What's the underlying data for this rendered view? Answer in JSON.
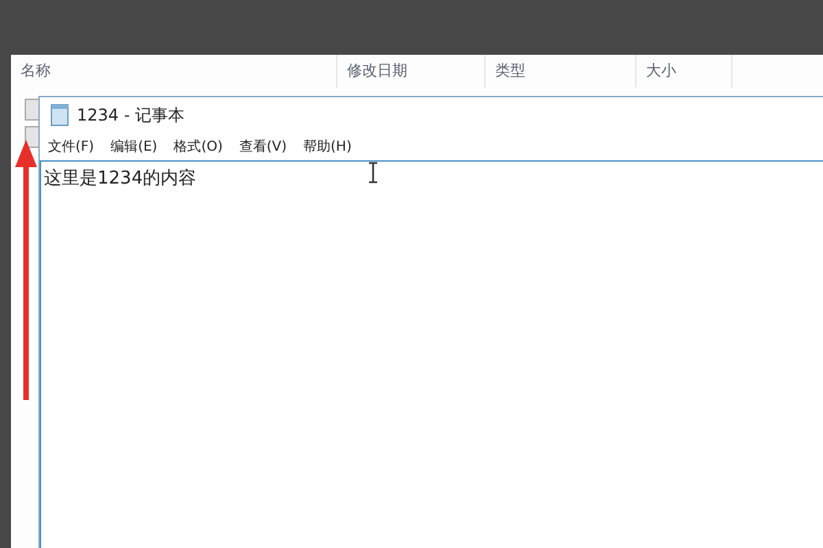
{
  "explorer": {
    "columns": [
      "名称",
      "修改日期",
      "类型",
      "大小"
    ]
  },
  "notepad": {
    "title": "1234 - 记事本",
    "menu": [
      "文件(F)",
      "编辑(E)",
      "格式(O)",
      "查看(V)",
      "帮助(H)"
    ],
    "content": "这里是1234的内容"
  }
}
